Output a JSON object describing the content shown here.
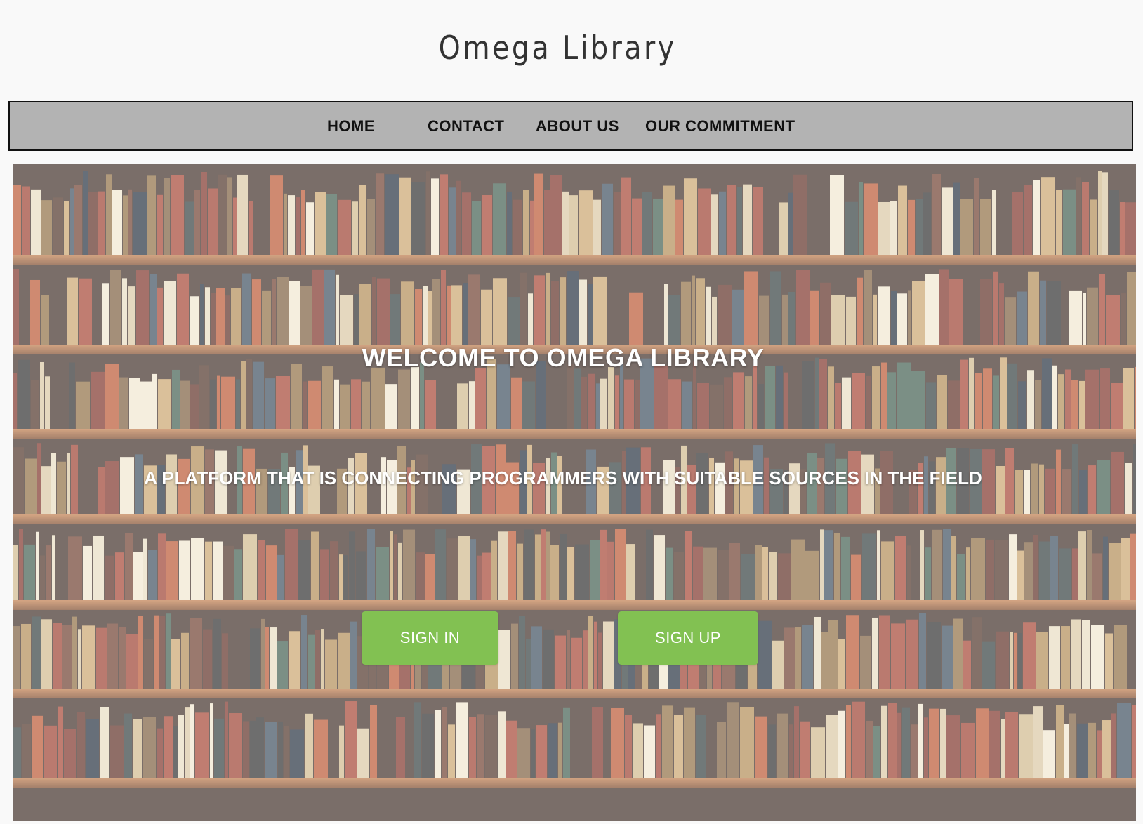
{
  "header": {
    "title": "Omega Library"
  },
  "nav": {
    "items": [
      {
        "label": "HOME"
      },
      {
        "label": "CONTACT"
      },
      {
        "label": "ABOUT US"
      },
      {
        "label": "OUR COMMITMENT"
      }
    ]
  },
  "hero": {
    "background": "bookshelf-photo",
    "title": "WELCOME TO OMEGA LIBRARY",
    "subtitle": "A PLATFORM THAT IS CONNECTING PROGRAMMERS WITH SUITABLE SOURCES IN THE FIELD",
    "buttons": {
      "signin": "SIGN IN",
      "signup": "SIGN UP"
    }
  },
  "colors": {
    "page_bg": "#f9f9f9",
    "nav_bg": "#b3b3b3",
    "button_green": "#82c152",
    "hero_text": "#ffffff"
  }
}
